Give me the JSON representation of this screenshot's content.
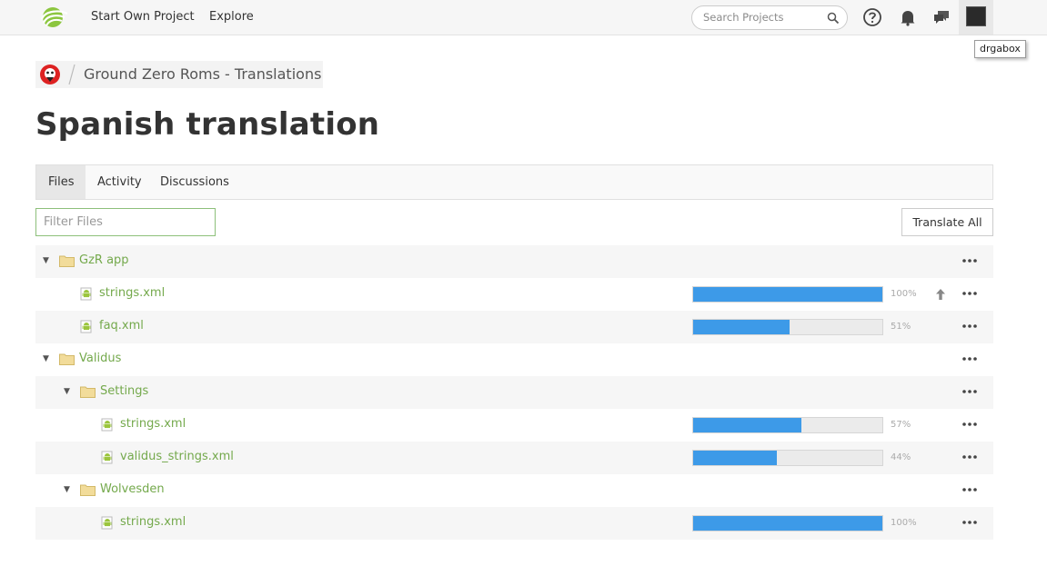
{
  "nav": {
    "start_project": "Start Own Project",
    "explore": "Explore",
    "search_placeholder": "Search Projects",
    "icons": [
      "crowdin-logo-icon",
      "search-icon",
      "help-icon",
      "bell-icon",
      "chat-icon"
    ]
  },
  "user": {
    "tooltip": "drgabox"
  },
  "breadcrumb": {
    "project": "Ground Zero Roms - Translations"
  },
  "page": {
    "title": "Spanish translation"
  },
  "tabs": [
    {
      "label": "Files",
      "active": true
    },
    {
      "label": "Activity",
      "active": false
    },
    {
      "label": "Discussions",
      "active": false
    }
  ],
  "filter": {
    "placeholder": "Filter Files"
  },
  "actions": {
    "translate_all": "Translate All"
  },
  "colors": {
    "link_green": "#74a94c",
    "progress_blue": "#3d9ae8",
    "folder_yellow": "#f2dc9a"
  },
  "tree": [
    {
      "type": "folder",
      "name": "GzR app",
      "depth": 0,
      "expanded": true
    },
    {
      "type": "file",
      "name": "strings.xml",
      "depth": 1,
      "progress": 100,
      "progress_label": "100%",
      "upload": true
    },
    {
      "type": "file",
      "name": "faq.xml",
      "depth": 1,
      "progress": 51,
      "progress_label": "51%"
    },
    {
      "type": "folder",
      "name": "Validus",
      "depth": 0,
      "expanded": true
    },
    {
      "type": "folder",
      "name": "Settings",
      "depth": 1,
      "expanded": true
    },
    {
      "type": "file",
      "name": "strings.xml",
      "depth": 2,
      "progress": 57,
      "progress_label": "57%"
    },
    {
      "type": "file",
      "name": "validus_strings.xml",
      "depth": 2,
      "progress": 44,
      "progress_label": "44%"
    },
    {
      "type": "folder",
      "name": "Wolvesden",
      "depth": 1,
      "expanded": true
    },
    {
      "type": "file",
      "name": "strings.xml",
      "depth": 2,
      "progress": 100,
      "progress_label": "100%"
    }
  ]
}
